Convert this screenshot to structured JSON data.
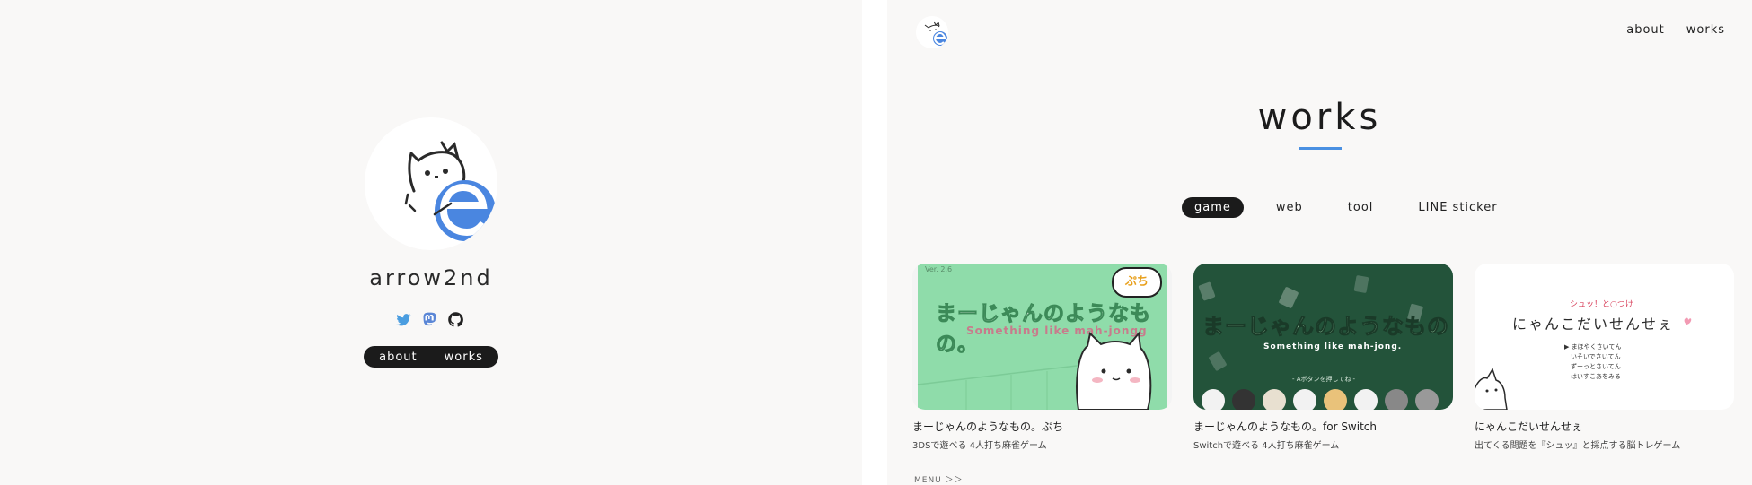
{
  "profile": {
    "name": "arrow2nd",
    "social": [
      {
        "icon": "twitter-icon",
        "color": "#4a9de0"
      },
      {
        "icon": "mastodon-icon",
        "color": "#5a86d6"
      },
      {
        "icon": "github-icon",
        "color": "#222222"
      }
    ],
    "nav": [
      "about",
      "works"
    ]
  },
  "header": {
    "nav": [
      "about",
      "works"
    ]
  },
  "page": {
    "heading": "works",
    "accent_color": "#4a90e2"
  },
  "tabs": [
    {
      "label": "game",
      "active": true
    },
    {
      "label": "web",
      "active": false
    },
    {
      "label": "tool",
      "active": false
    },
    {
      "label": "LINE sticker",
      "active": false
    }
  ],
  "cards": [
    {
      "title": "まーじゃんのようなもの。ぷち",
      "description": "3DSで遊べる 4人打ち麻雀ゲーム",
      "thumb": {
        "bg": "#8fdcaa",
        "version": "Ver. 2.6",
        "logo": "まーじゃんのようなもの。",
        "subtitle": "Something like mah-jongg",
        "badge": "ぷち"
      }
    },
    {
      "title": "まーじゃんのようなもの。for Switch",
      "description": "Switchで遊べる 4人打ち麻雀ゲーム",
      "thumb": {
        "bg": "#23533a",
        "logo": "まーじゃんのようなもの",
        "subtitle": "Something like mah-jong.",
        "caption": "- Aボタンを押してね -"
      }
    },
    {
      "title": "にゃんこだいせんせぇ",
      "description": "出てくる問題を『シュッ』と採点する脳トレゲーム",
      "thumb": {
        "bg": "#ffffff",
        "kicker": "シュッ！と○つけ",
        "logo": "にゃんこだいせんせぇ",
        "menu": [
          "▶ まほやくさいてん",
          "いそいでさいてん",
          "ずーっとさいてん",
          "はいすこあをみる"
        ]
      }
    }
  ],
  "menu_label": "MENU ＞＞"
}
